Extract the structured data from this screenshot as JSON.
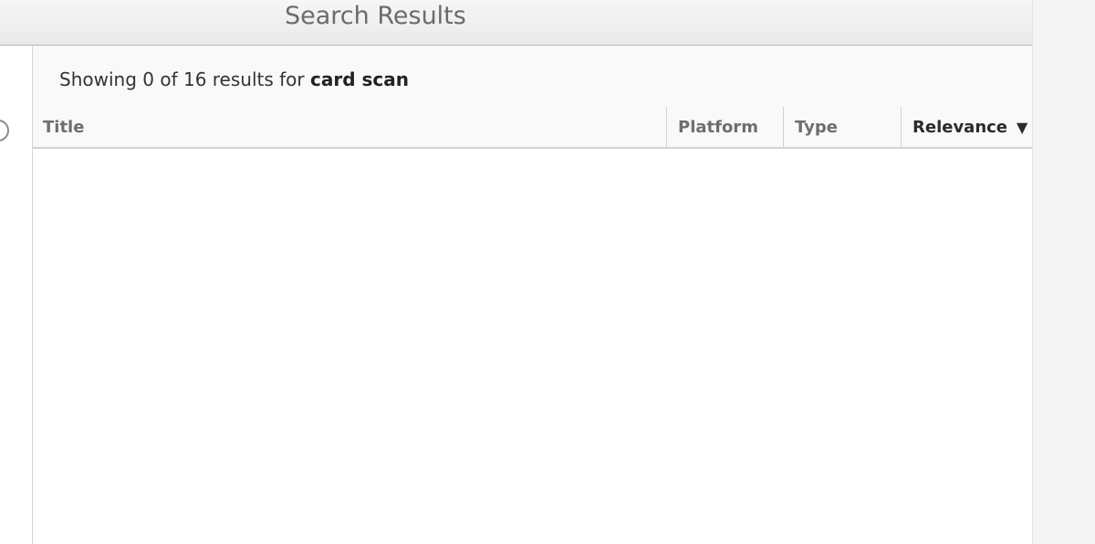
{
  "window": {
    "title": "Search Results"
  },
  "search": {
    "summary_prefix": "Showing 0 of 16 results for ",
    "query": "card scan"
  },
  "table": {
    "columns": [
      {
        "label": "Title"
      },
      {
        "label": "Platform"
      },
      {
        "label": "Type"
      },
      {
        "label": "Relevance"
      }
    ],
    "sort_indicator": "▼",
    "rows": []
  },
  "icons": {
    "back": "back-circle-icon",
    "sort": "sort-descending-icon"
  },
  "colors": {
    "titlebar_text": "#6b6b6b",
    "header_text": "#6e6e6e",
    "active_sort_text": "#2b2b2b",
    "summary_text": "#333333"
  }
}
